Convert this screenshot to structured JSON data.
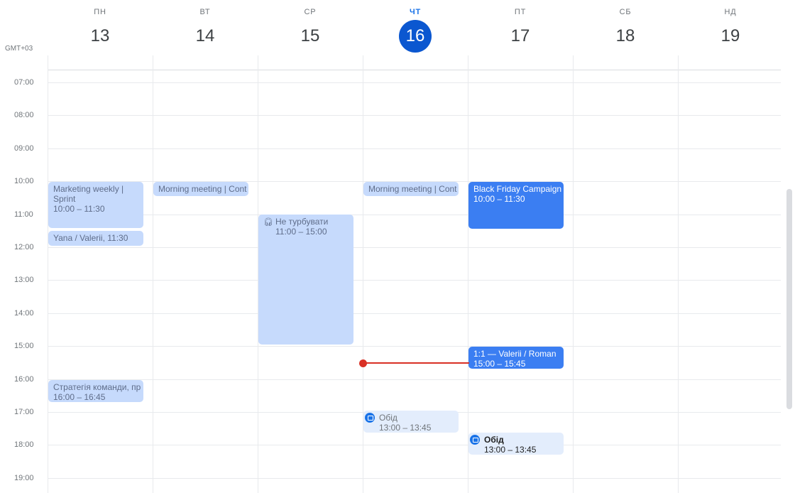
{
  "timezone": "GMT+03",
  "days": [
    {
      "name": "ПН",
      "num": "13"
    },
    {
      "name": "ВТ",
      "num": "14"
    },
    {
      "name": "СР",
      "num": "15"
    },
    {
      "name": "ЧТ",
      "num": "16"
    },
    {
      "name": "ПТ",
      "num": "17"
    },
    {
      "name": "СБ",
      "num": "18"
    },
    {
      "name": "НД",
      "num": "19"
    }
  ],
  "hours": [
    "07:00",
    "08:00",
    "09:00",
    "10:00",
    "11:00",
    "12:00",
    "13:00",
    "14:00",
    "15:00",
    "16:00",
    "17:00",
    "18:00",
    "19:00"
  ],
  "events": {
    "marketing": {
      "title": "Marketing weekly | Sprint",
      "time": "10:00 – 11:30"
    },
    "yana": {
      "title": "Yana / Valerii, 11:30"
    },
    "strategy": {
      "title": "Стратегія команди, пр",
      "time": "16:00 – 16:45"
    },
    "morning_tue": {
      "title": "Morning meeting | Cont"
    },
    "dnd": {
      "title": "Не турбувати",
      "time": "11:00 – 15:00",
      "icon": "headphones-icon"
    },
    "morning_thu": {
      "title": "Morning meeting | Cont"
    },
    "lunch_thu": {
      "title": "Обід",
      "time": "13:00 – 13:45",
      "icon": "calendar-icon"
    },
    "black_friday": {
      "title": "Black Friday Campaign",
      "time": "10:00 – 11:30"
    },
    "lunch_fri": {
      "title": "Обід",
      "time": "13:00 – 13:45",
      "icon": "calendar-icon"
    },
    "one_on_one": {
      "title": "1:1 — Valerii / Roman",
      "time": "15:00 – 15:45"
    }
  },
  "colors": {
    "today": "#0b57d0",
    "event_light": "#c6dafc",
    "event_blue": "#3b7ef2",
    "now_line": "#d93025"
  }
}
